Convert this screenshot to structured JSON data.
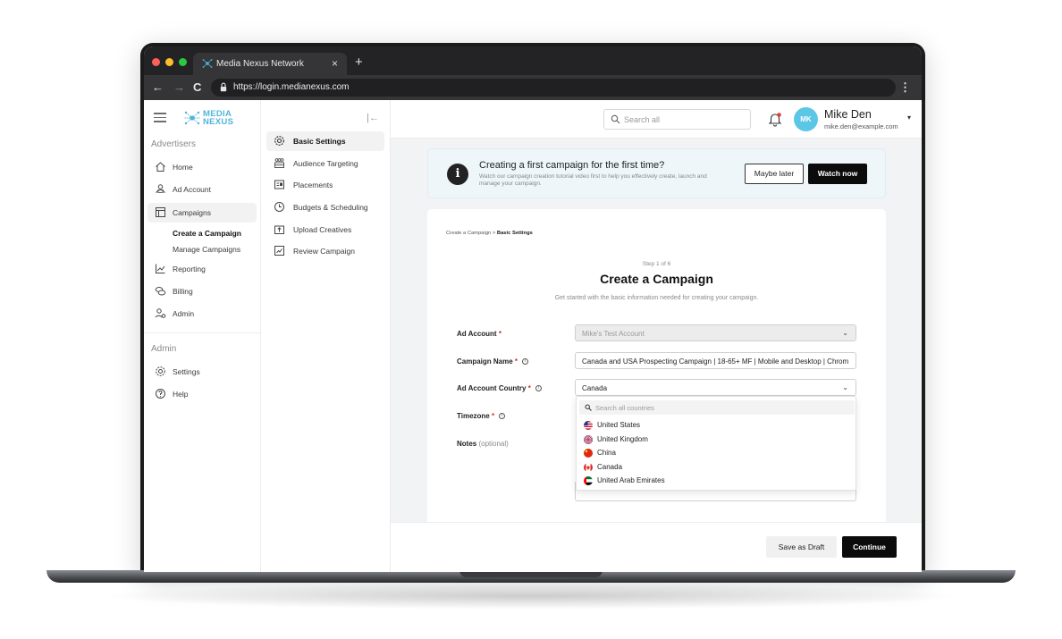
{
  "browser": {
    "tab_title": "Media Nexus Network",
    "tab_close": "×",
    "new_tab": "+",
    "url": "https://login.medianexus.com",
    "back": "←",
    "forward": "→",
    "reload": "C",
    "menu": "⋮"
  },
  "brand": {
    "line1": "MEDIA",
    "line2": "NEXUS",
    "accent_color": "#4fb5d8"
  },
  "sidebar": {
    "section_advertisers": "Advertisers",
    "items": [
      {
        "label": "Home",
        "icon": "home-icon"
      },
      {
        "label": "Ad Account",
        "icon": "ad-account-icon"
      },
      {
        "label": "Campaigns",
        "icon": "campaigns-icon"
      }
    ],
    "campaign_subitems": [
      {
        "label": "Create a Campaign"
      },
      {
        "label": "Manage Campaigns"
      }
    ],
    "items_after": [
      {
        "label": "Reporting",
        "icon": "reporting-icon"
      },
      {
        "label": "Billing",
        "icon": "billing-icon"
      },
      {
        "label": "Admin",
        "icon": "admin-icon"
      }
    ],
    "section_admin": "Admin",
    "admin_items": [
      {
        "label": "Settings",
        "icon": "settings-icon"
      },
      {
        "label": "Help",
        "icon": "help-icon"
      }
    ]
  },
  "steps": {
    "collapse_glyph": "|←",
    "items": [
      {
        "label": "Basic Settings",
        "icon": "gear-icon"
      },
      {
        "label": "Audience Targeting",
        "icon": "audience-icon"
      },
      {
        "label": "Placements",
        "icon": "placements-icon"
      },
      {
        "label": "Budgets & Scheduling",
        "icon": "clock-icon"
      },
      {
        "label": "Upload Creatives",
        "icon": "upload-icon"
      },
      {
        "label": "Review Campaign",
        "icon": "review-icon"
      }
    ]
  },
  "header": {
    "search_placeholder": "Search all",
    "user_initials": "MK",
    "user_name": "Mike Den",
    "user_email": "mike.den@example.com",
    "caret": "▾"
  },
  "banner": {
    "title": "Creating a first campaign for the first time?",
    "text": "Watch our campaign creation tutorial video first to help you effectively create, launch and manage your campaign.",
    "maybe_label": "Maybe later",
    "watch_label": "Watch now",
    "info_glyph": "i"
  },
  "form": {
    "breadcrumb_root": "Create a Campaign >",
    "breadcrumb_current": "Basic Settings",
    "step_count": "Step 1 of 6",
    "title": "Create a Campaign",
    "subtitle": "Get started with the basic information needed for creating your campaign.",
    "ad_account": {
      "label": "Ad Account",
      "value": "Mike's Test Account"
    },
    "campaign_name": {
      "label": "Campaign Name",
      "value": "Canada and USA Prospecting Campaign | 18-65+ MF | Mobile and Desktop | Chrom"
    },
    "country": {
      "label": "Ad Account Country",
      "value": "Canada"
    },
    "timezone": {
      "label": "Timezone"
    },
    "notes": {
      "label": "Notes",
      "optional": "(optional)"
    },
    "required_mark": "*",
    "info_glyph": "i",
    "caret": "⌄"
  },
  "country_dropdown": {
    "search_placeholder": "Search all countries",
    "options": [
      {
        "label": "United States",
        "flag": "us-flag-icon"
      },
      {
        "label": "United Kingdom",
        "flag": "uk-flag-icon"
      },
      {
        "label": "China",
        "flag": "china-flag-icon"
      },
      {
        "label": "Canada",
        "flag": "canada-flag-icon"
      },
      {
        "label": "United Arab Emirates",
        "flag": "uae-flag-icon"
      }
    ]
  },
  "footer": {
    "draft_label": "Save as Draft",
    "continue_label": "Continue"
  }
}
